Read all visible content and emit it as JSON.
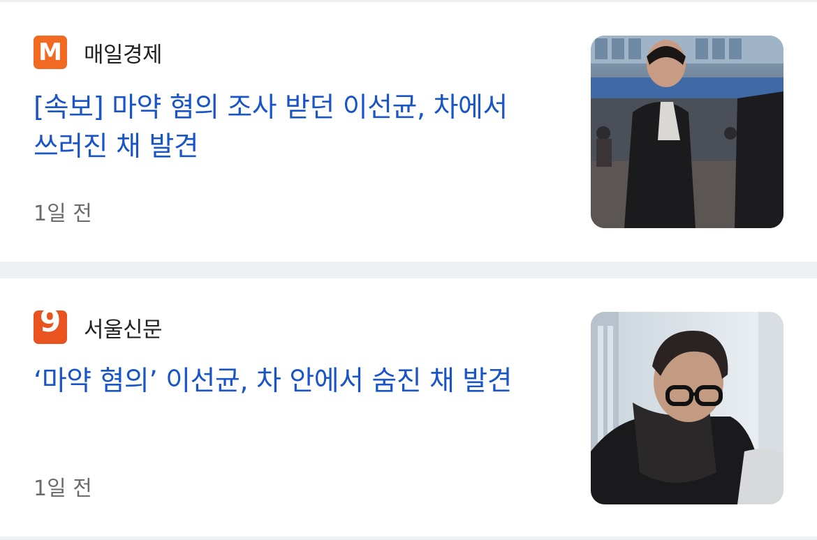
{
  "articles": [
    {
      "source": "매일경제",
      "logo_glyph": "M",
      "logo_color": "#f26a21",
      "headline": "[속보] 마약 혐의 조사 받던 이선균, 차에서 쓰러진 채 발견",
      "time": "1일 전"
    },
    {
      "source": "서울신문",
      "logo_glyph": "9",
      "logo_color": "#e8531f",
      "headline": "‘마약 혐의’ 이선균, 차 안에서 숨진 채 발견",
      "time": "1일 전"
    }
  ],
  "colors": {
    "headline": "#1a55c8",
    "background": "#eef0f3",
    "card": "#ffffff",
    "meta": "#6b6b6b"
  }
}
